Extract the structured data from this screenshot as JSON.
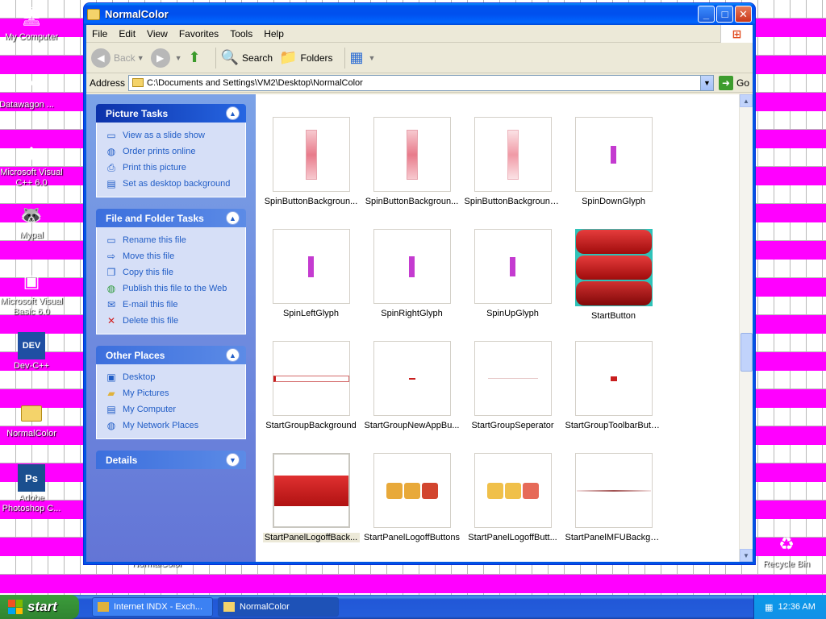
{
  "desktop": {
    "icons": [
      {
        "label": "My Computer"
      },
      {
        "label": "Datawagon ..."
      },
      {
        "label": "Microsoft Visual C++ 6.0"
      },
      {
        "label": "Mypal"
      },
      {
        "label": "Microsoft Visual Basic 6.0"
      },
      {
        "label": "Dev-C++"
      },
      {
        "label": "NormalColor"
      },
      {
        "label": "Adobe Photoshop C..."
      },
      {
        "label": "Recycle Bin"
      },
      {
        "label": "NormalColor"
      }
    ]
  },
  "window": {
    "title": "NormalColor",
    "menu": [
      "File",
      "Edit",
      "View",
      "Favorites",
      "Tools",
      "Help"
    ],
    "toolbar": {
      "back": "Back",
      "search": "Search",
      "folders": "Folders"
    },
    "address": {
      "label": "Address",
      "value": "C:\\Documents and Settings\\VM2\\Desktop\\NormalColor",
      "go": "Go"
    }
  },
  "taskpane": {
    "picture_tasks": {
      "title": "Picture Tasks",
      "items": [
        "View as a slide show",
        "Order prints online",
        "Print this picture",
        "Set as desktop background"
      ]
    },
    "file_tasks": {
      "title": "File and Folder Tasks",
      "items": [
        "Rename this file",
        "Move this file",
        "Copy this file",
        "Publish this file to the Web",
        "E-mail this file",
        "Delete this file"
      ]
    },
    "other_places": {
      "title": "Other Places",
      "items": [
        "Desktop",
        "My Pictures",
        "My Computer",
        "My Network Places"
      ]
    },
    "details": {
      "title": "Details"
    }
  },
  "files": [
    {
      "name": "SpinButtonBackgroun..."
    },
    {
      "name": "SpinButtonBackgroun..."
    },
    {
      "name": "SpinButtonBackgroundUp"
    },
    {
      "name": "SpinDownGlyph"
    },
    {
      "name": "SpinLeftGlyph"
    },
    {
      "name": "SpinRightGlyph"
    },
    {
      "name": "SpinUpGlyph"
    },
    {
      "name": "StartButton"
    },
    {
      "name": "StartGroupBackground"
    },
    {
      "name": "StartGroupNewAppBu..."
    },
    {
      "name": "StartGroupSeperator"
    },
    {
      "name": "StartGroupToolbarButton"
    },
    {
      "name": "StartPanelLogoffBack..."
    },
    {
      "name": "StartPanelLogoffButtons"
    },
    {
      "name": "StartPanelLogoffButt..."
    },
    {
      "name": "StartPanelMFUBackgro..."
    }
  ],
  "taskbar": {
    "start": "start",
    "tasks": [
      {
        "label": "Internet INDX - Exch..."
      },
      {
        "label": "NormalColor"
      }
    ],
    "clock": "12:36 AM"
  },
  "colors": {
    "accent": "#0054e3",
    "desktop_stripe": "#ff00ff",
    "glyph": "#c43bd0",
    "start_red": "#c81e1e"
  }
}
